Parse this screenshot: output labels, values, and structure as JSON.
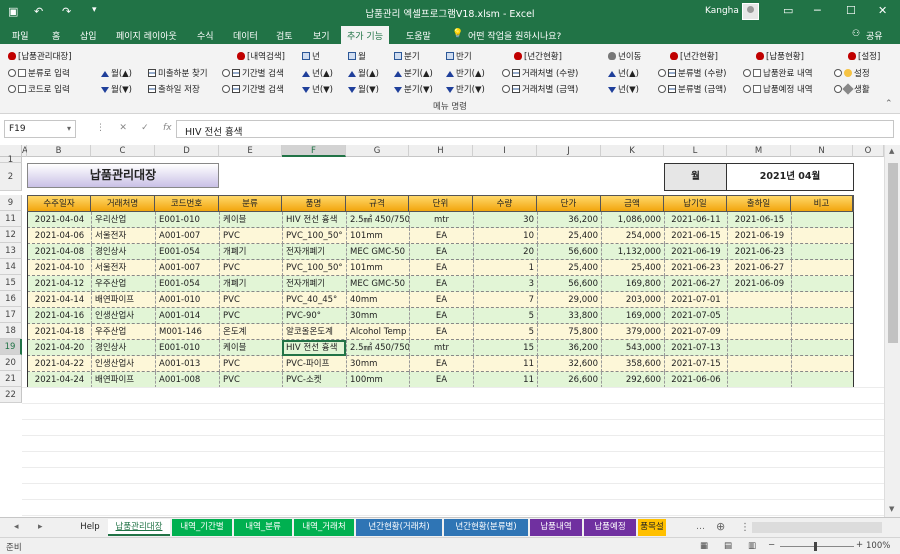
{
  "window": {
    "title": "납품관리 엑셀프로그램V18.xlsm - Excel",
    "user": "Kangha",
    "share_label": "공유"
  },
  "menu_tabs": [
    "파일",
    "홈",
    "삽입",
    "페이지 레이아웃",
    "수식",
    "데이터",
    "검토",
    "보기",
    "추가 기능",
    "도움말",
    "어떤 작업을 원하시나요?"
  ],
  "ribbon": {
    "group_label": "메뉴 명령",
    "items": [
      "[납품관리대장]",
      "분류로 입력",
      "코드로 입력",
      "월(▲)",
      "월(▼)",
      "미출하분 찾기",
      "출하일 저장",
      "[내역검색]",
      "기간별 검색",
      "기간별 검색",
      "년",
      "년(▲)",
      "년(▼)",
      "월(▲)",
      "월(▼)",
      "월",
      "분기",
      "분기(▲)",
      "분기(▼)",
      "반기",
      "반기(▲)",
      "반기(▼)",
      "[년간현황]",
      "거래처별 (수량)",
      "거래처별 (금액)",
      "년이동",
      "년(▲)",
      "년(▼)",
      "[년간현황]",
      "분류별 (수량)",
      "분류별 (금액)",
      "[납품현황]",
      "납품완료 내역",
      "납품예정 내역",
      "[설정]",
      "설정",
      "생활"
    ]
  },
  "formula_bar": {
    "name_box": "F19",
    "formula": "HIV 전선 흉색"
  },
  "columns": [
    "A",
    "B",
    "C",
    "D",
    "E",
    "F",
    "G",
    "H",
    "I",
    "J",
    "K",
    "L",
    "M",
    "N",
    "O"
  ],
  "sheet": {
    "title": "납품관리대장",
    "month_label": "월",
    "month_value": "2021년 04월",
    "headers": [
      "수주일자",
      "거래처명",
      "코드번호",
      "분류",
      "품명",
      "규격",
      "단위",
      "수량",
      "단가",
      "금액",
      "납기일",
      "출하일",
      "비고"
    ],
    "rows": [
      {
        "r": "11",
        "cells": [
          "2021-04-04",
          "우리산업",
          "E001-010",
          "케이블",
          "HIV 전선 흉색",
          "2.5㎟ 450/750V",
          "mtr",
          "30",
          "36,200",
          "1,086,000",
          "2021-06-11",
          "2021-06-15",
          ""
        ]
      },
      {
        "r": "12",
        "cells": [
          "2021-04-06",
          "서울전자",
          "A001-007",
          "PVC",
          "PVC_100_50°",
          "101mm",
          "EA",
          "10",
          "25,400",
          "254,000",
          "2021-06-15",
          "2021-06-19",
          ""
        ]
      },
      {
        "r": "13",
        "cells": [
          "2021-04-08",
          "경인상사",
          "E001-054",
          "개폐기",
          "전자개폐기",
          "MEC GMC-50",
          "EA",
          "20",
          "56,600",
          "1,132,000",
          "2021-06-19",
          "2021-06-23",
          ""
        ]
      },
      {
        "r": "14",
        "cells": [
          "2021-04-10",
          "서울전자",
          "A001-007",
          "PVC",
          "PVC_100_50°",
          "101mm",
          "EA",
          "1",
          "25,400",
          "25,400",
          "2021-06-23",
          "2021-06-27",
          ""
        ]
      },
      {
        "r": "15",
        "cells": [
          "2021-04-12",
          "우주산업",
          "E001-054",
          "개폐기",
          "전자개폐기",
          "MEC GMC-50",
          "EA",
          "3",
          "56,600",
          "169,800",
          "2021-06-27",
          "2021-06-09",
          ""
        ]
      },
      {
        "r": "16",
        "cells": [
          "2021-04-14",
          "배연파이프",
          "A001-010",
          "PVC",
          "PVC_40_45°",
          "40mm",
          "EA",
          "7",
          "29,000",
          "203,000",
          "2021-07-01",
          "",
          ""
        ]
      },
      {
        "r": "17",
        "cells": [
          "2021-04-16",
          "인생산업사",
          "A001-014",
          "PVC",
          "PVC-90°",
          "30mm",
          "EA",
          "5",
          "33,800",
          "169,000",
          "2021-07-05",
          "",
          ""
        ]
      },
      {
        "r": "18",
        "cells": [
          "2021-04-18",
          "우주산업",
          "M001-146",
          "온도계",
          "알코올온도계",
          "Alcohol Temp",
          "EA",
          "5",
          "75,800",
          "379,000",
          "2021-07-09",
          "",
          ""
        ]
      },
      {
        "r": "19",
        "cells": [
          "2021-04-20",
          "경인상사",
          "E001-010",
          "케이블",
          "HIV 전선 흉색",
          "2.5㎟ 450/750V",
          "mtr",
          "15",
          "36,200",
          "543,000",
          "2021-07-13",
          "",
          ""
        ]
      },
      {
        "r": "20",
        "cells": [
          "2021-04-22",
          "인생산업사",
          "A001-013",
          "PVC",
          "PVC-파이프",
          "30mm",
          "EA",
          "11",
          "32,600",
          "358,600",
          "2021-07-15",
          "",
          ""
        ]
      },
      {
        "r": "21",
        "cells": [
          "2021-04-24",
          "배연파이프",
          "A001-008",
          "PVC",
          "PVC-소켓",
          "100mm",
          "EA",
          "11",
          "26,600",
          "292,600",
          "2021-06-06",
          "",
          ""
        ]
      }
    ]
  },
  "sheet_tabs": [
    {
      "label": "Help",
      "color": "plain"
    },
    {
      "label": "납품관리대장",
      "color": "active"
    },
    {
      "label": "내역_기간별",
      "color": "#00b050"
    },
    {
      "label": "내역_분류",
      "color": "#00b050"
    },
    {
      "label": "내역_거래처",
      "color": "#00b050"
    },
    {
      "label": "년간현황(거래처)",
      "color": "#2f75b5"
    },
    {
      "label": "년간현황(분류별)",
      "color": "#2f75b5"
    },
    {
      "label": "납품내역",
      "color": "#7030a0"
    },
    {
      "label": "납품예정",
      "color": "#7030a0"
    },
    {
      "label": "품목설",
      "color": "#ffc000"
    }
  ],
  "status": {
    "ready": "준비",
    "zoom": "100%"
  }
}
